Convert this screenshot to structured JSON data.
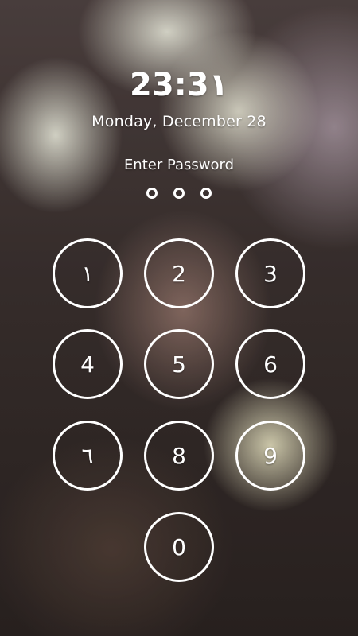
{
  "lockscreen": {
    "time": "23:3١",
    "date": "Monday, December 28",
    "prompt": "Enter Password",
    "pin_length": 3,
    "keys": [
      "١",
      "2",
      "3",
      "4",
      "5",
      "6",
      "٦",
      "8",
      "9",
      "0"
    ]
  },
  "colors": {
    "accent": "#ffffff"
  }
}
